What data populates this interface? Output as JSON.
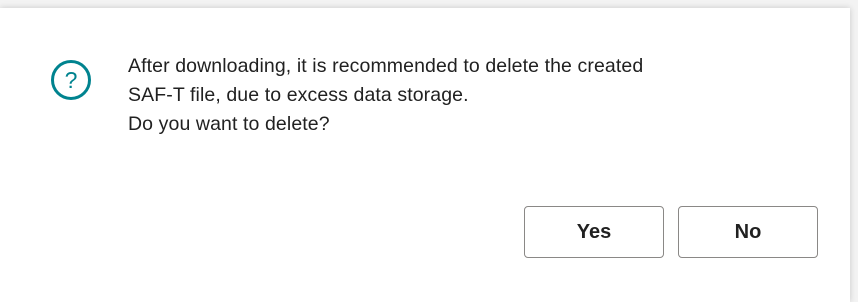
{
  "dialog": {
    "icon": "question-circle-icon",
    "accent_color": "#00838f",
    "message_lines": [
      "After downloading, it is recommended to delete the created",
      "SAF-T file, due to excess data storage.",
      "Do you want to delete?"
    ],
    "buttons": {
      "yes_label": "Yes",
      "no_label": "No"
    }
  }
}
